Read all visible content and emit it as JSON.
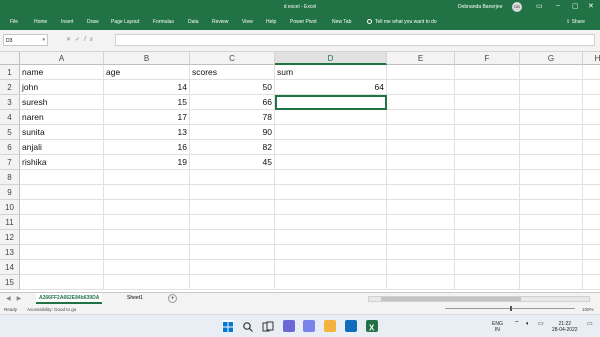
{
  "window": {
    "title": "d excel - Excel",
    "user": "Debnanda Banerjee",
    "avatar_initials": "DB"
  },
  "ribbon": {
    "tabs": [
      "File",
      "Home",
      "Insert",
      "Draw",
      "Page Layout",
      "Formulas",
      "Data",
      "Review",
      "View",
      "Help",
      "Power Pivot",
      "New Tab"
    ],
    "tell_me": "Tell me what you want to do",
    "share": "Share"
  },
  "formula_bar": {
    "name_box": "D3",
    "formula": ""
  },
  "sheet": {
    "columns": [
      "A",
      "B",
      "C",
      "D",
      "E",
      "F",
      "G",
      "H"
    ],
    "active_column": "D",
    "rows": [
      "1",
      "2",
      "3",
      "4",
      "5",
      "6",
      "7",
      "8",
      "9",
      "10",
      "11",
      "12",
      "13",
      "14",
      "15"
    ],
    "cells": [
      [
        "name",
        "age",
        "scores",
        "sum"
      ],
      [
        "john",
        "14",
        "50",
        "64"
      ],
      [
        "suresh",
        "15",
        "66",
        ""
      ],
      [
        "naren",
        "17",
        "78",
        ""
      ],
      [
        "sunita",
        "13",
        "90",
        ""
      ],
      [
        "anjali",
        "16",
        "82",
        ""
      ],
      [
        "rishika",
        "19",
        "45",
        ""
      ]
    ]
  },
  "sheet_tabs": [
    "A266FF2A662E84b639DA",
    "Sheet1"
  ],
  "status": {
    "ready": "Ready",
    "accessibility": "Accessibility: Good to go",
    "zoom": "100%"
  },
  "taskbar": {
    "lang": "ENG",
    "region": "IN",
    "time": "21:22",
    "date": "28-04-2022"
  },
  "colors": {
    "excel_green": "#217346",
    "header_gray": "#f3f3f3"
  }
}
